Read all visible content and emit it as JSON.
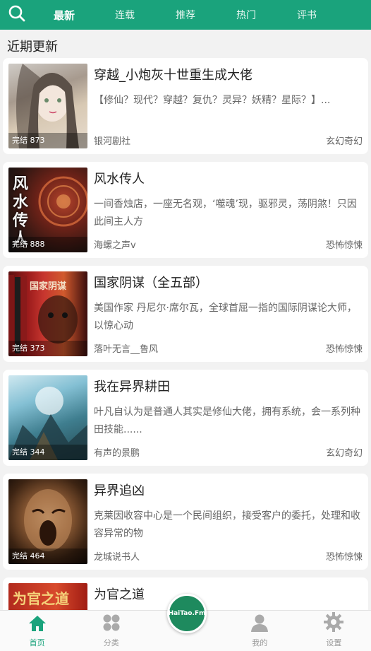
{
  "nav": {
    "tabs": [
      "最新",
      "连载",
      "推荐",
      "热门",
      "评书"
    ]
  },
  "section_title": "近期更新",
  "books": [
    {
      "title": "穿越_小炮灰十世重生成大佬",
      "desc": "【修仙？现代？穿越？复仇？灵异？妖精？星际？】...",
      "author": "银河剧社",
      "genre": "玄幻奇幻",
      "badge": "完结 873"
    },
    {
      "title": "风水传人",
      "desc": "一间香烛店，一座无名观，‘噬魂’现，驱邪灵，荡阴煞！只因此间主人方",
      "author": "海螺之声v",
      "genre": "恐怖惊悚",
      "badge": "完结 888"
    },
    {
      "title": "国家阴谋（全五部）",
      "desc": " 美国作家 丹尼尔·席尔瓦，全球首屈一指的国际阴谋论大师，以惊心动",
      "author": "落叶无言__鲁风",
      "genre": "恐怖惊悚",
      "badge": "完结 373"
    },
    {
      "title": "我在异界耕田",
      "desc": "叶凡自认为是普通人其实是修仙大佬，拥有系统，会一系列种田技能......",
      "author": "有声的景鹏",
      "genre": "玄幻奇幻",
      "badge": "完结 344"
    },
    {
      "title": "异界追凶",
      "desc": " 克莱因收容中心是一个民间组织，接受客户的委托，处理和收容异常的物",
      "author": "龙城说书人",
      "genre": "恐怖惊悚",
      "badge": "完结 464"
    },
    {
      "title": "为官之道",
      "desc": "",
      "author": "",
      "genre": "",
      "badge": ""
    }
  ],
  "covers": {
    "c2_text": "风水传人",
    "c3_text": "国家阴谋",
    "c6_text": "为官之道"
  },
  "bottom_nav": {
    "home": "首页",
    "category": "分类",
    "player": "HaiTao.Fm",
    "mine": "我的",
    "settings": "设置"
  },
  "colors": {
    "brand": "#1aa37c"
  }
}
